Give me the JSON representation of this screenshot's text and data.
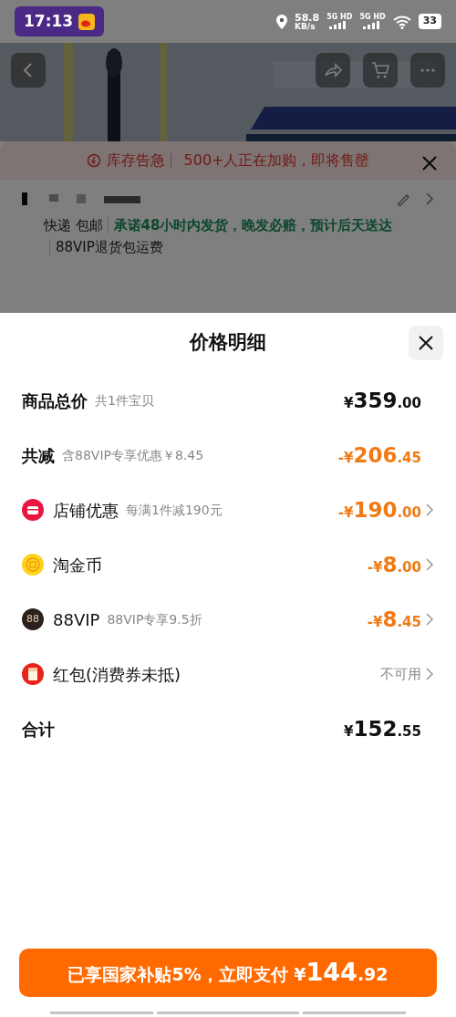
{
  "status_bar": {
    "time": "17:13",
    "speed": "58.8",
    "speed_unit": "KB/s",
    "networks": [
      "5G HD",
      "5G HD"
    ],
    "battery": "33"
  },
  "background_page": {
    "alert_label": "库存告急",
    "alert_text": "500+人正在加购，即将售罄",
    "shipping": [
      "快递",
      "包邮"
    ],
    "promise": "承诺48小时内发货，晚发必赔，预计后天送达",
    "return_note": "88VIP退货包运费"
  },
  "sheet": {
    "title": "价格明细",
    "rows": [
      {
        "kind": "plain",
        "label": "商品总价",
        "note": "共1件宝贝",
        "prefix": "¥",
        "integer": "359",
        "decimal": ".00",
        "color": "#111111",
        "chevron": false
      },
      {
        "kind": "plain",
        "label": "共减",
        "note": "含88VIP专享优惠￥8.45",
        "prefix": "-¥",
        "integer": "206",
        "decimal": ".45",
        "color": "#f07a14",
        "chevron": false
      },
      {
        "kind": "store",
        "label": "店铺优惠",
        "note": "每满1件减190元",
        "prefix": "-¥",
        "integer": "190",
        "decimal": ".00",
        "color": "#f07a14",
        "chevron": true
      },
      {
        "kind": "coin",
        "label": "淘金币",
        "prefix": "-¥",
        "integer": "8",
        "decimal": ".00",
        "color": "#f07a14",
        "chevron": true
      },
      {
        "kind": "vip",
        "icon_text": "88",
        "label": "88VIP",
        "note": "88VIP专享9.5折",
        "prefix": "-¥",
        "integer": "8",
        "decimal": ".45",
        "color": "#f07a14",
        "chevron": true
      },
      {
        "kind": "redpacket",
        "label": "红包(消费券未抵)",
        "status": "不可用",
        "chevron": true
      },
      {
        "kind": "plain",
        "label": "合计",
        "prefix": "¥",
        "integer": "152",
        "decimal": ".55",
        "color": "#111111",
        "chevron": false
      }
    ]
  },
  "pay_button": {
    "text": "已享国家补贴5%，立即支付",
    "prefix": "¥",
    "integer": "144",
    "decimal": ".92"
  }
}
